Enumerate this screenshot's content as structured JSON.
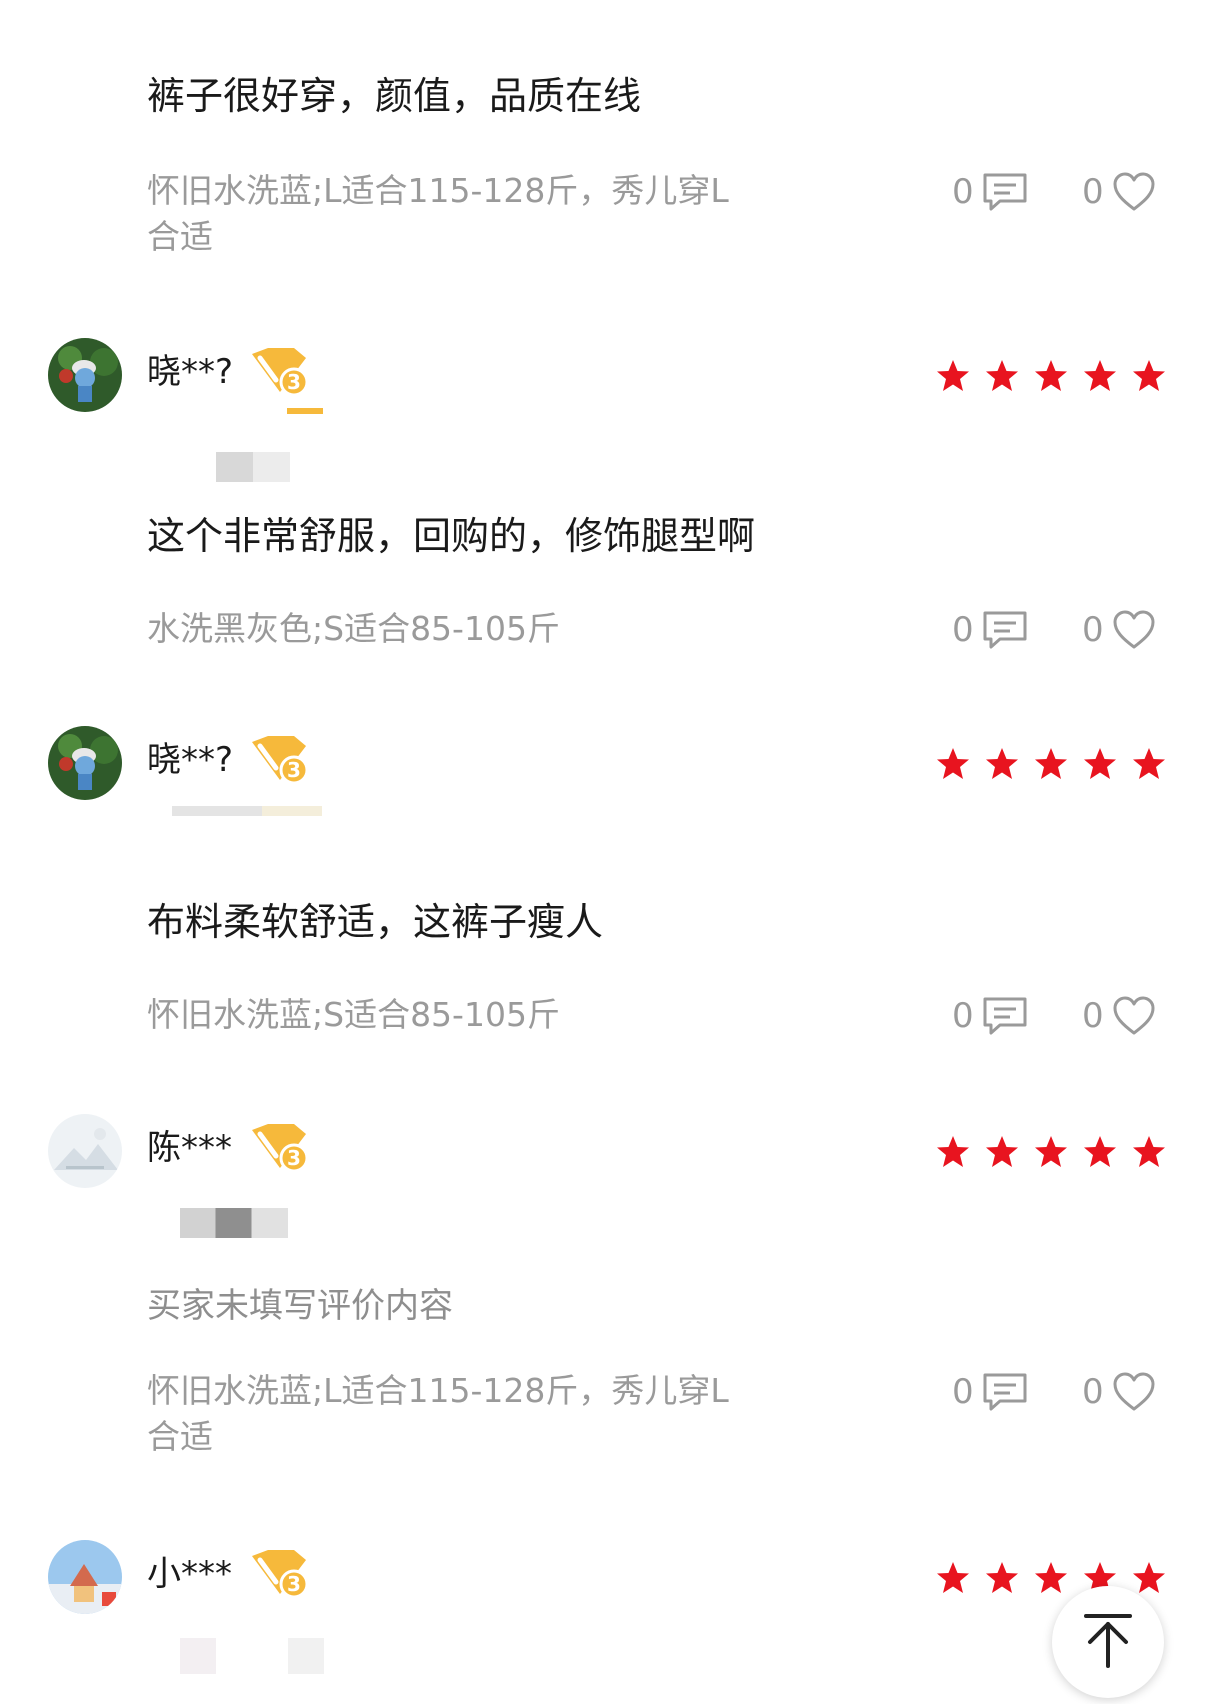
{
  "reviews": [
    {
      "text": "裤子很好穿，颜值，品质在线",
      "spec_line1": "怀旧水洗蓝;L适合115-128斤，秀儿穿L",
      "spec_line2": "合适",
      "comments": "0",
      "likes": "0"
    },
    {
      "username": "晓**?",
      "vip_level": "3",
      "rating": 5,
      "text": "这个非常舒服，回购的，修饰腿型啊",
      "spec_line1": "水洗黑灰色;S适合85-105斤",
      "comments": "0",
      "likes": "0"
    },
    {
      "username": "晓**?",
      "vip_level": "3",
      "rating": 5,
      "text": "布料柔软舒适，这裤子瘦人",
      "spec_line1": "怀旧水洗蓝;S适合85-105斤",
      "comments": "0",
      "likes": "0"
    },
    {
      "username": "陈***",
      "vip_level": "3",
      "rating": 5,
      "text": "买家未填写评价内容",
      "spec_line1": "怀旧水洗蓝;L适合115-128斤，秀儿穿L",
      "spec_line2": "合适",
      "comments": "0",
      "likes": "0"
    },
    {
      "username": "小***",
      "vip_level": "3",
      "rating": 5
    }
  ],
  "colors": {
    "star": "#e8141f",
    "vip_badge": "#f6b93b",
    "muted_text": "#9a9a9a"
  },
  "icons": {
    "comment": "comment-icon",
    "like": "heart-icon",
    "back_to_top": "arrow-up-icon",
    "vip": "vip-badge-icon",
    "rating": "star-icon"
  }
}
